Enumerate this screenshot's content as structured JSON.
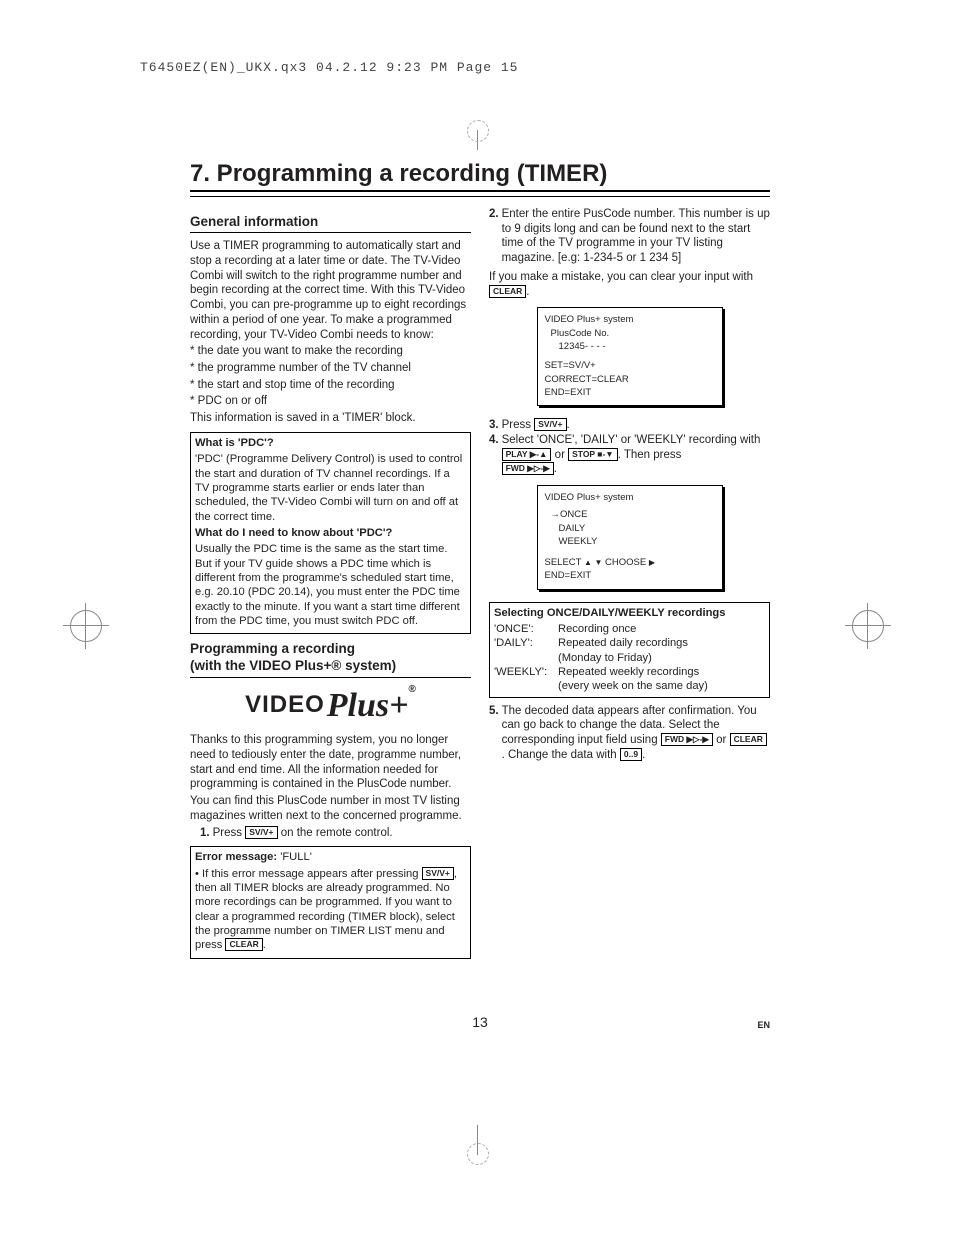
{
  "print_header": "T6450EZ(EN)_UKX.qx3  04.2.12  9:23 PM  Page 15",
  "chapter_title": "7. Programming a recording (TIMER)",
  "sec_general": "General information",
  "general_p1": "Use a TIMER programming to automatically start and stop a recording at a later time or date. The TV-Video Combi will switch to the right programme number and begin recording at the correct time. With this TV-Video Combi, you can pre-programme up to eight recordings within a period of one year. To make a programmed recording, your TV-Video Combi needs to know:",
  "general_b1": "* the date you want to make the recording",
  "general_b2": "* the programme number of the TV channel",
  "general_b3": "* the start and stop time of the recording",
  "general_b4": "* PDC on or off",
  "general_p2": "This information is saved in a 'TIMER' block.",
  "pdc_head1": "What is 'PDC'?",
  "pdc_p1": "'PDC' (Programme Delivery Control) is used to control the start and duration of TV channel recordings. If a TV programme starts earlier or ends later than scheduled, the TV-Video Combi will turn on and off at the correct time.",
  "pdc_head2": "What do I need to know about 'PDC'?",
  "pdc_p2": "Usually the PDC time is the same as the start time. But if your TV guide shows a PDC time which is different from the programme's scheduled start time, e.g. 20.10 (PDC 20.14), you must enter the PDC time exactly to the minute. If you want a start time different from the PDC time, you must switch PDC off.",
  "sec_vplus_l1": "Programming a recording",
  "sec_vplus_l2": "(with the VIDEO Plus+® system)",
  "logo_video": "VIDEO",
  "logo_plus": "Plus+",
  "logo_sup": "®",
  "vplus_p1": "Thanks to this programming system, you no longer need to tediously enter the date, programme number, start and end time. All the information needed for programming is contained in the PlusCode number.",
  "vplus_p2": "You can find this PlusCode number in most TV listing magazines written next to the concerned programme.",
  "step1_num": "1.",
  "step1_a": "Press ",
  "step1_b": " on the remote control.",
  "btn_svv": "SV/V+",
  "err_head": "Error message: ",
  "err_full": "'FULL'",
  "err_p_a": "• If this error message appears after pressing ",
  "err_p_b": ", then all TIMER blocks are already programmed. No more recordings can be programmed. If you want to clear a programmed recording (TIMER block), select the programme number on TIMER LIST menu and press ",
  "btn_clear": "CLEAR",
  "step2_num": "2.",
  "step2_txt": "Enter the entire PusCode number. This number is up to 9 digits long and can be found next to the start time of the TV programme in your TV listing magazine. [e.g: 1-234-5 or 1 234 5]",
  "mistake_a": "If you make a mistake, you can clear your input with ",
  "osd1_l1": "VIDEO Plus+ system",
  "osd1_l2": "PlusCode No.",
  "osd1_l3": "12345- - - -",
  "osd1_l4": "SET=SV/V+",
  "osd1_l5": "CORRECT=CLEAR",
  "osd1_l6": "END=EXIT",
  "step3_num": "3.",
  "step3_a": "Press ",
  "step4_num": "4.",
  "step4_a": "Select 'ONCE', 'DAILY' or 'WEEKLY' recording with ",
  "step4_b": " or ",
  "step4_c": ". Then press ",
  "btn_play": "PLAY ▶-▲",
  "btn_stop": "STOP ■-▼",
  "btn_fwd": "FWD ▶▷-▶",
  "osd2_l1": "VIDEO Plus+ system",
  "osd2_l2": "→ONCE",
  "osd2_l3": "DAILY",
  "osd2_l4": "WEEKLY",
  "osd2_l5a": "SELECT ",
  "osd2_l5b": "  CHOOSE ",
  "osd2_l6": "END=EXIT",
  "sel_head": "Selecting ONCE/DAILY/WEEKLY recordings",
  "sel_once_k": "'ONCE':",
  "sel_once_v": "Recording once",
  "sel_daily_k": "'DAILY':",
  "sel_daily_v1": "Repeated daily recordings",
  "sel_daily_v2": "(Monday to Friday)",
  "sel_week_k": "'WEEKLY':",
  "sel_week_v1": "Repeated weekly recordings",
  "sel_week_v2": "(every week on the same day)",
  "step5_num": "5.",
  "step5_a": "The decoded data appears after confirmation. You can go back to change the data. Select the corresponding input field using ",
  "step5_b": " or ",
  "step5_c": ". Change the data with ",
  "btn_09": "0..9",
  "page_number": "13",
  "lang": "EN",
  "dot": ".",
  "tri_up": "▲",
  "tri_dn": "▼",
  "tri_r": "▶"
}
